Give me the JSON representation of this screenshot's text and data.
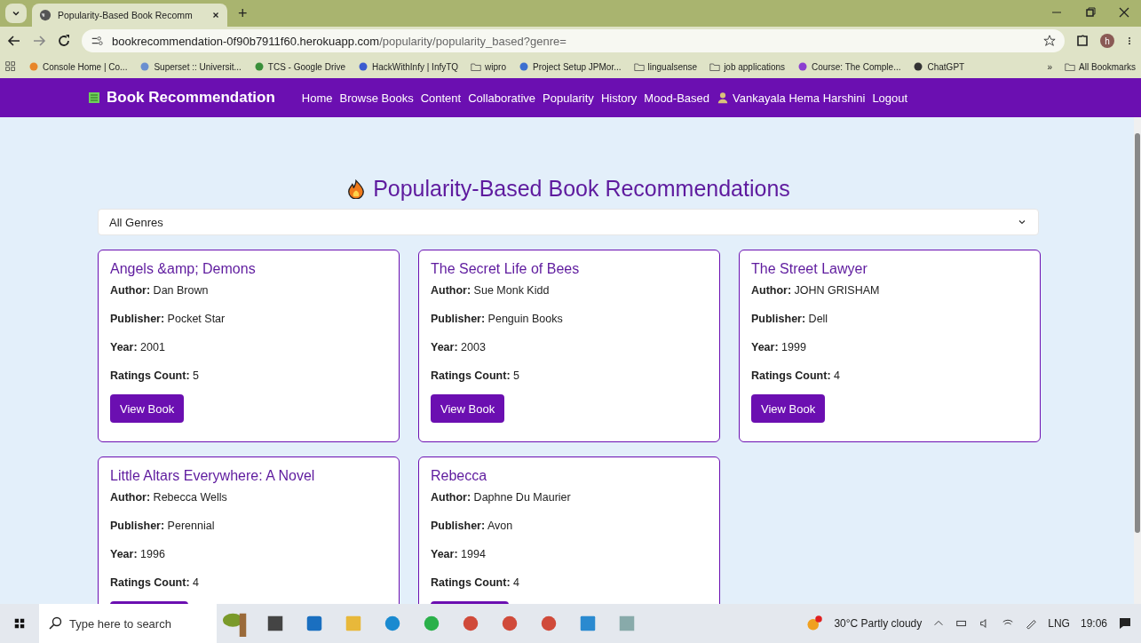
{
  "browser": {
    "tab_title": "Popularity-Based Book Recomm",
    "new_tab": "+",
    "url_host": "bookrecommendation-0f90b7911f60.herokuapp.com",
    "url_path": "/popularity/popularity_based?genre=",
    "bookmarks": [
      "Console Home | Co...",
      "Superset :: Universit...",
      "TCS - Google Drive",
      "HackWithInfy | InfyTQ",
      "wipro",
      "Project Setup JPMor...",
      "lingualsense",
      "job applications",
      "Course: The Comple...",
      "ChatGPT"
    ],
    "more": "»",
    "all_bookmarks": "All Bookmarks",
    "profile": "h"
  },
  "navbar": {
    "brand": "Book Recommendation",
    "links": [
      {
        "label": "Home",
        "kind": "link"
      },
      {
        "label": "Browse Books",
        "kind": "link"
      },
      {
        "label": "Content",
        "kind": "link"
      },
      {
        "label": "Collaborative",
        "kind": "link"
      },
      {
        "label": "Popularity",
        "kind": "link"
      },
      {
        "label": "History",
        "kind": "link"
      },
      {
        "label": "Mood-Based",
        "kind": "link"
      },
      {
        "label": "Vankayala Hema Harshini",
        "kind": "user"
      },
      {
        "label": "Logout",
        "kind": "link"
      }
    ]
  },
  "page": {
    "heading": "Popularity-Based Book Recommendations",
    "genre_select": "All Genres",
    "books": [
      {
        "title": "Angels &amp; Demons",
        "fields": [
          {
            "label": "Author:",
            "value": "Dan Brown"
          },
          {
            "label": "Publisher:",
            "value": "Pocket Star"
          },
          {
            "label": "Year:",
            "value": "2001"
          },
          {
            "label": "Ratings Count:",
            "value": "5"
          }
        ],
        "button": "View Book"
      },
      {
        "title": "The Secret Life of Bees",
        "fields": [
          {
            "label": "Author:",
            "value": "Sue Monk Kidd"
          },
          {
            "label": "Publisher:",
            "value": "Penguin Books"
          },
          {
            "label": "Year:",
            "value": "2003"
          },
          {
            "label": "Ratings Count:",
            "value": "5"
          }
        ],
        "button": "View Book"
      },
      {
        "title": "The Street Lawyer",
        "fields": [
          {
            "label": "Author:",
            "value": "JOHN GRISHAM"
          },
          {
            "label": "Publisher:",
            "value": "Dell"
          },
          {
            "label": "Year:",
            "value": "1999"
          },
          {
            "label": "Ratings Count:",
            "value": "4"
          }
        ],
        "button": "View Book"
      },
      {
        "title": "Little Altars Everywhere: A Novel",
        "fields": [
          {
            "label": "Author:",
            "value": "Rebecca Wells"
          },
          {
            "label": "Publisher:",
            "value": "Perennial"
          },
          {
            "label": "Year:",
            "value": "1996"
          },
          {
            "label": "Ratings Count:",
            "value": "4"
          }
        ]
      },
      {
        "title": "Rebecca",
        "fields": [
          {
            "label": "Author:",
            "value": "Daphne Du Maurier"
          },
          {
            "label": "Publisher:",
            "value": "Avon"
          },
          {
            "label": "Year:",
            "value": "1994"
          },
          {
            "label": "Ratings Count:",
            "value": "4"
          }
        ]
      }
    ]
  },
  "taskbar": {
    "search_placeholder": "Type here to search",
    "weather": "30°C  Partly cloudy",
    "language": "LNG",
    "time": "19:06"
  }
}
